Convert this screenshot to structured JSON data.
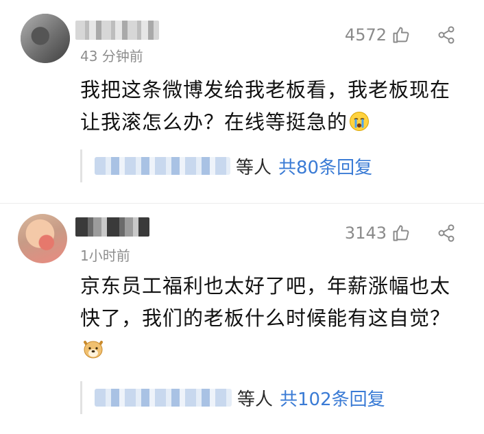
{
  "comments": [
    {
      "time": "43 分钟前",
      "likes": "4572",
      "text": "我把这条微博发给我老板看，我老板现在让我滚怎么办？在线等挺急的",
      "emoji": "crying-face-emoji",
      "reply_suffix": "等人",
      "reply_total": "共80条回复"
    },
    {
      "time": "1小时前",
      "likes": "3143",
      "text": "京东员工福利也太好了吧，年薪涨幅也太快了，我们的老板什么时候能有这自觉？",
      "emoji": "doge-emoji",
      "reply_suffix": "等人",
      "reply_total": "共102条回复"
    }
  ],
  "icons": {
    "like": "thumbs-up-icon",
    "share": "share-icon"
  },
  "colors": {
    "link_blue": "#3a7bd5",
    "meta_gray": "#8a8a8a",
    "text": "#111111"
  }
}
